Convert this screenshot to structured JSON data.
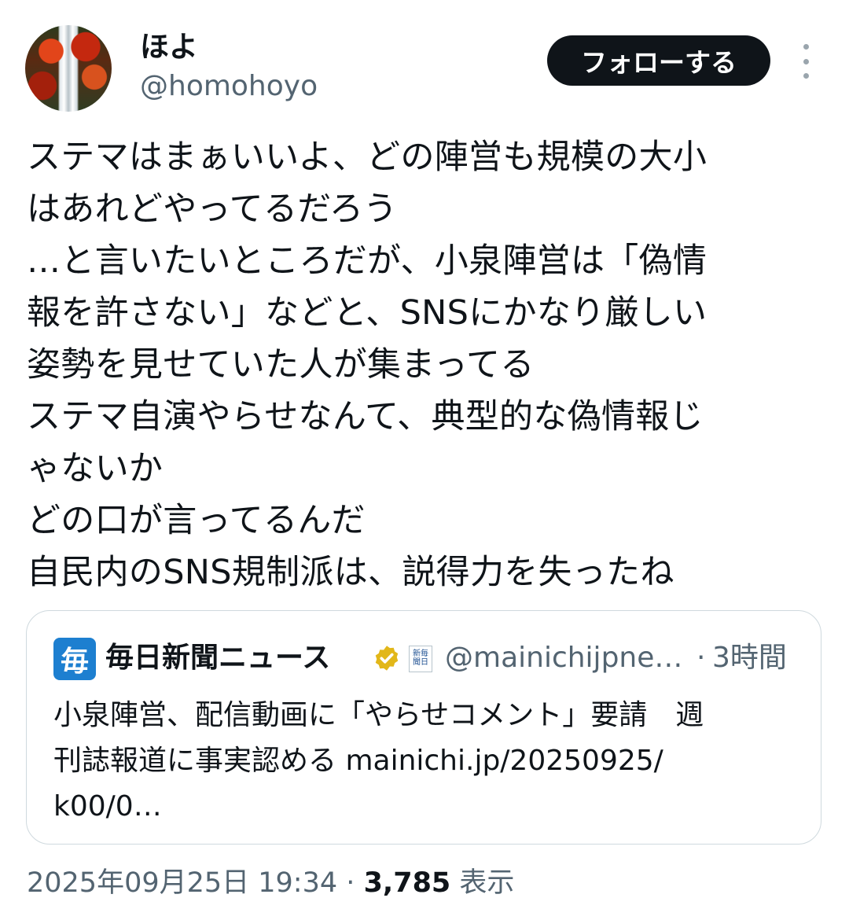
{
  "author": {
    "name": "ほよ",
    "handle": "@homohoyo",
    "follow_label": "フォローする"
  },
  "tweet": {
    "lines": [
      "ステマはまぁいいよ、どの陣営も規模の大小",
      "はあれどやってるだろう",
      "…と言いたいところだが、小泉陣営は「偽情",
      "報を許さない」などと、SNSにかなり厳しい",
      "姿勢を見せていた人が集まってる",
      "ステマ自演やらせなんて、典型的な偽情報じ",
      "ゃないか",
      "どの口が言ってるんだ",
      "自民内のSNS規制派は、説得力を失ったね"
    ]
  },
  "quote": {
    "logo_char": "毎",
    "name": "毎日新聞ニュース",
    "affiliation_label": "新毎聞日",
    "handle": "@mainichijpne…",
    "separator": "·",
    "time": "3時間",
    "lines": [
      "小泉陣営、配信動画に「やらせコメント」要請　週",
      "刊誌報道に事実認める mainichi.jp/20250925/",
      "k00/0…"
    ],
    "badge_color": "#e2b719"
  },
  "meta": {
    "datetime": "2025年09月25日 19:34",
    "separator": "·",
    "views": "3,785",
    "views_label": "表示"
  }
}
